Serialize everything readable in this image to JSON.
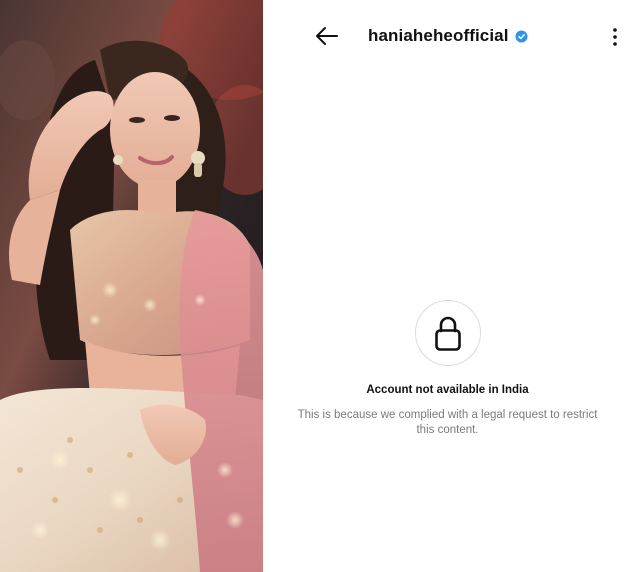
{
  "photo": {
    "description_icon": "profile-photo"
  },
  "header": {
    "back_icon": "arrow-left-icon",
    "username": "haniaheheofficial",
    "verified_icon": "verified-badge-icon",
    "more_icon": "more-vertical-icon"
  },
  "restricted": {
    "icon": "lock-icon",
    "title": "Account not available in India",
    "description": "This is because we complied with a legal request to restrict this content."
  },
  "colors": {
    "verified_blue": "#2a95ea",
    "text_primary": "#111111",
    "text_secondary": "#7a7a7a",
    "circle_border": "#dcdcdc"
  }
}
